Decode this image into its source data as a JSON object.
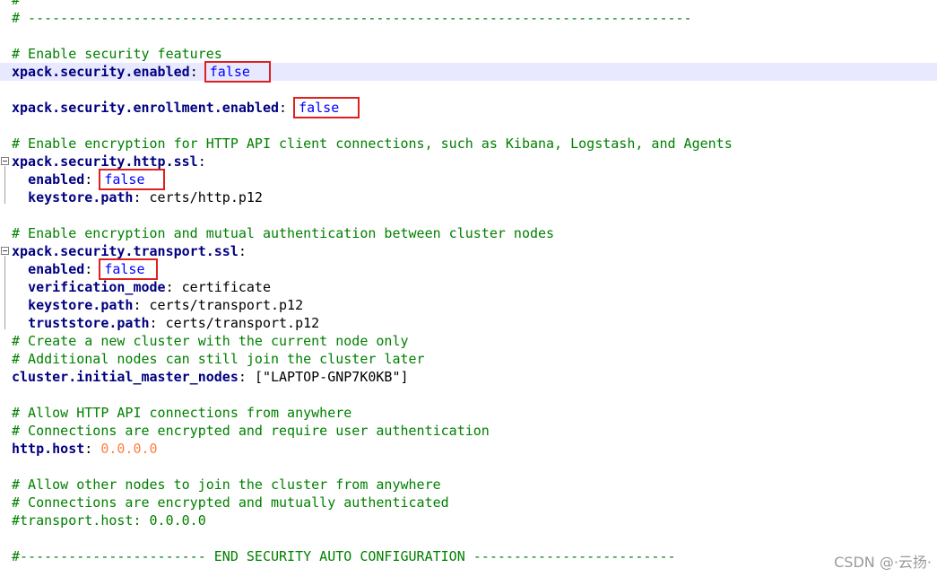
{
  "editor": {
    "lines": [
      {
        "t": "comment",
        "text": "#"
      },
      {
        "t": "comment",
        "text": "# ----------------------------------------------------------------------------------"
      },
      {
        "t": "blank"
      },
      {
        "t": "comment",
        "text": "# Enable security features"
      },
      {
        "t": "kv",
        "key": "xpack.security.enabled",
        "value": "false",
        "vtype": "bool",
        "highlight": true,
        "current": true,
        "boxw": 70
      },
      {
        "t": "blank"
      },
      {
        "t": "kv",
        "key": "xpack.security.enrollment.enabled",
        "value": "false",
        "vtype": "bool",
        "highlight": true,
        "boxw": 70
      },
      {
        "t": "blank"
      },
      {
        "t": "comment",
        "text": "# Enable encryption for HTTP API client connections, such as Kibana, Logstash, and Agents"
      },
      {
        "t": "section",
        "key": "xpack.security.http.ssl",
        "fold": true
      },
      {
        "t": "kv",
        "indent": 2,
        "key": "enabled",
        "value": "false",
        "vtype": "bool",
        "highlight": true,
        "boxw": 70
      },
      {
        "t": "kv",
        "indent": 2,
        "key": "keystore.path",
        "value": "certs/http.p12",
        "vtype": "plain"
      },
      {
        "t": "blank"
      },
      {
        "t": "comment",
        "text": "# Enable encryption and mutual authentication between cluster nodes"
      },
      {
        "t": "section",
        "key": "xpack.security.transport.ssl",
        "fold": true
      },
      {
        "t": "kv",
        "indent": 2,
        "key": "enabled",
        "value": "false",
        "vtype": "bool",
        "highlight": true,
        "boxw": 62
      },
      {
        "t": "kv",
        "indent": 2,
        "key": "verification_mode",
        "value": "certificate",
        "vtype": "plain"
      },
      {
        "t": "kv",
        "indent": 2,
        "key": "keystore.path",
        "value": "certs/transport.p12",
        "vtype": "plain"
      },
      {
        "t": "kv",
        "indent": 2,
        "key": "truststore.path",
        "value": "certs/transport.p12",
        "vtype": "plain"
      },
      {
        "t": "comment",
        "text": "# Create a new cluster with the current node only"
      },
      {
        "t": "comment",
        "text": "# Additional nodes can still join the cluster later"
      },
      {
        "t": "kv",
        "key": "cluster.initial_master_nodes",
        "value": "[\"LAPTOP-GNP7K0KB\"]",
        "vtype": "plain"
      },
      {
        "t": "blank"
      },
      {
        "t": "comment",
        "text": "# Allow HTTP API connections from anywhere"
      },
      {
        "t": "comment",
        "text": "# Connections are encrypted and require user authentication"
      },
      {
        "t": "kv",
        "key": "http.host",
        "value": "0.0.0.0",
        "vtype": "ip"
      },
      {
        "t": "blank"
      },
      {
        "t": "comment",
        "text": "# Allow other nodes to join the cluster from anywhere"
      },
      {
        "t": "comment",
        "text": "# Connections are encrypted and mutually authenticated"
      },
      {
        "t": "comment",
        "text": "#transport.host: 0.0.0.0"
      },
      {
        "t": "blank"
      },
      {
        "t": "comment",
        "text": "#----------------------- END SECURITY AUTO CONFIGURATION -------------------------"
      }
    ]
  },
  "watermark": "CSDN @·云扬·",
  "colors": {
    "comment": "#008000",
    "key": "#000080",
    "bool": "#0000ff",
    "ip": "#ff8040",
    "highlight_box": "#e02020",
    "current_line": "#e8e8ff"
  }
}
